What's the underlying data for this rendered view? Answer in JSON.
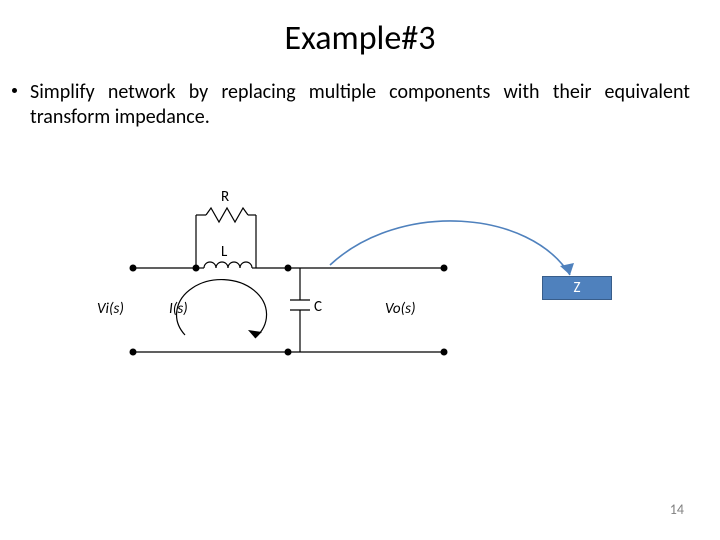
{
  "slide": {
    "title": "Example#3",
    "bullet_text": "Simplify network by replacing multiple components with their equivalent transform impedance.",
    "number": "14"
  },
  "circuit": {
    "labels": {
      "R": "R",
      "L": "L",
      "C": "C",
      "Vi": "Vi(s)",
      "Vo": "Vo(s)",
      "I": "I(s)",
      "Z": "Z"
    }
  }
}
